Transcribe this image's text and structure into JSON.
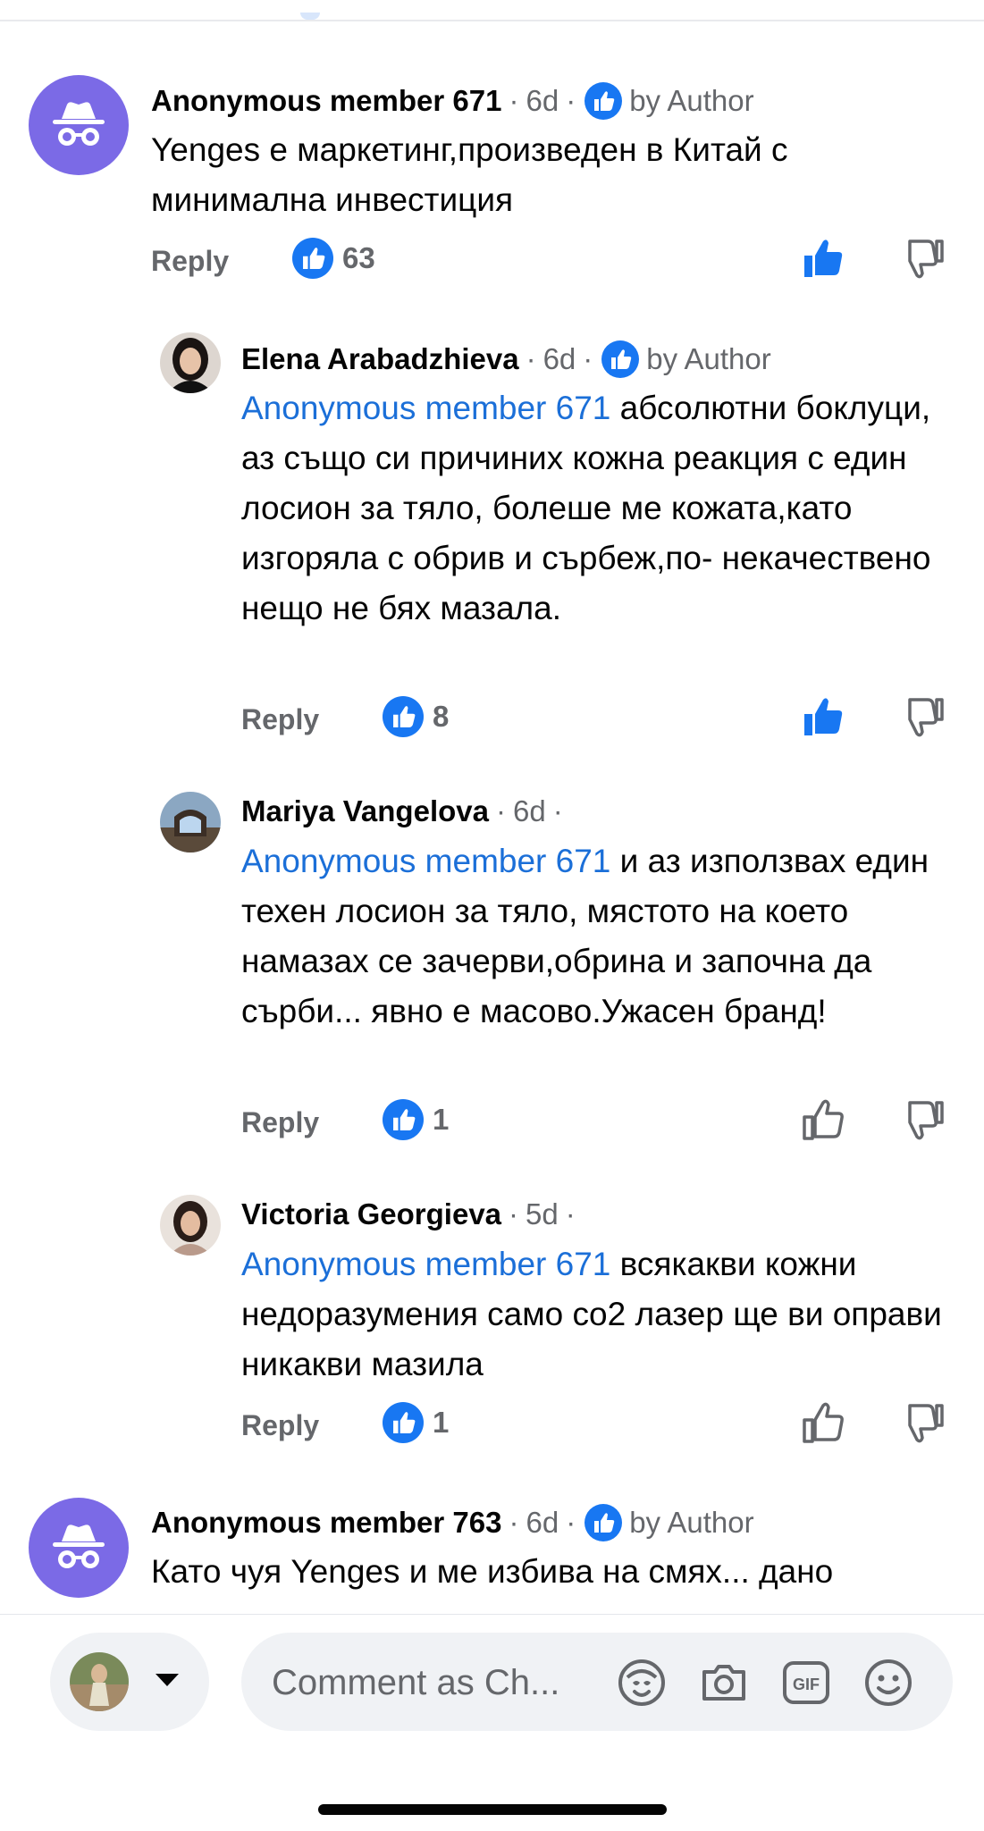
{
  "comments": [
    {
      "name": "Anonymous member 671",
      "time": "6d",
      "author_label": "by Author",
      "text": "Yenges е маркетинг,произведен в Китай с минимална инвестиция",
      "reply_label": "Reply",
      "like_count": "63",
      "liked": true
    },
    {
      "name": "Elena Arabadzhieva",
      "time": "6d",
      "author_label": "by Author",
      "mention": "Anonymous member 671",
      "text": "абсолютни боклуци, аз също си причиних кожна реакция с един лосион за тяло, болеше ме кожата,като изгоряла с обрив и сърбеж,по- некачествено нещо не бях мазала.",
      "reply_label": "Reply",
      "like_count": "8",
      "liked": true
    },
    {
      "name": "Mariya Vangelova",
      "time": "6d",
      "mention": "Anonymous member 671",
      "text": "и аз използвах един техен лосион за тяло, мястото на което намазах се зачерви,обрина и започна да сърби... явно е масово.Ужасен бранд!",
      "reply_label": "Reply",
      "like_count": "1",
      "liked": false
    },
    {
      "name": "Victoria Georgieva",
      "time": "5d",
      "mention": "Anonymous member 671",
      "text": "всякакви кожни недоразумения само co2 лазер ще ви оправи никакви мазила",
      "reply_label": "Reply",
      "like_count": "1",
      "liked": false
    },
    {
      "name": "Anonymous member 763",
      "time": "6d",
      "author_label": "by Author",
      "text": "Като чуя Yenges и ме избива на смях... дано"
    }
  ],
  "composer": {
    "placeholder": "Comment as Ch..."
  },
  "colors": {
    "link": "#1b6fd8",
    "like_blue": "#1877f2",
    "anon_avatar": "#7b6ae6",
    "secondary_text": "#65676b"
  }
}
